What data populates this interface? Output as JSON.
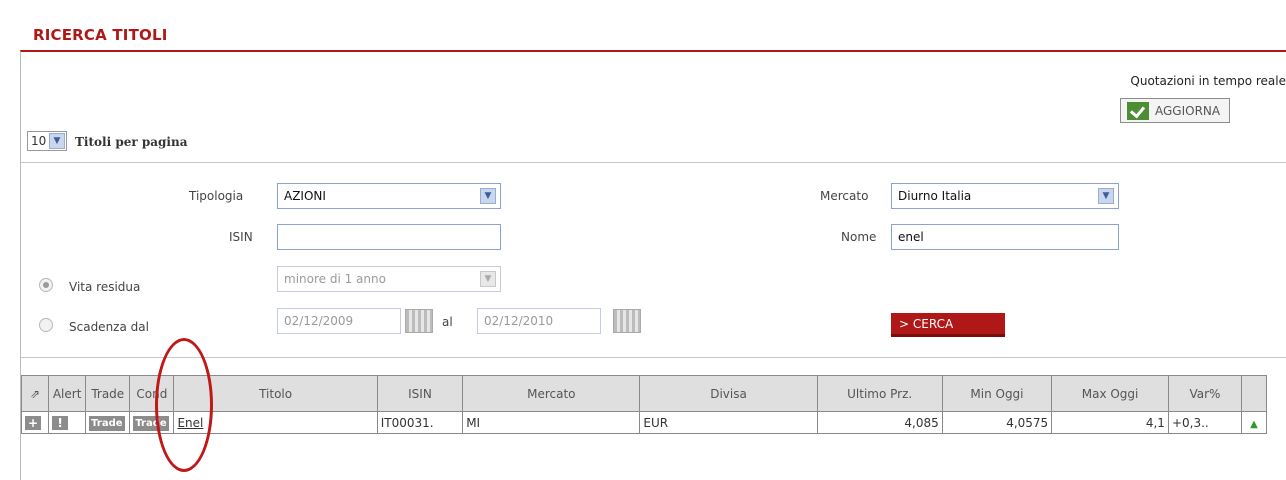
{
  "page": {
    "title": "RICERCA TITOLI",
    "realtime_label": "Quotazioni in tempo reale",
    "refresh_label": "AGGIORNA",
    "per_page_value": "10",
    "per_page_label": "Titoli per pagina"
  },
  "form": {
    "tipologia_label": "Tipologia",
    "tipologia_value": "AZIONI",
    "isin_label": "ISIN",
    "isin_value": "",
    "vita_residua_label": "Vita residua",
    "vita_residua_value": "minore di 1 anno",
    "scadenza_label": "Scadenza dal",
    "scadenza_from": "02/12/2009",
    "al_label": "al",
    "scadenza_to": "02/12/2010",
    "mercato_label": "Mercato",
    "mercato_value": "Diurno Italia",
    "nome_label": "Nome",
    "nome_value": "enel",
    "search_label": "> CERCA"
  },
  "table": {
    "headers": [
      "",
      "Alert",
      "Trade",
      "Cond",
      "Titolo",
      "ISIN",
      "Mercato",
      "Divisa",
      "Ultimo Prz.",
      "Min Oggi",
      "Max Oggi",
      "Var%",
      ""
    ],
    "rows": [
      {
        "add": "+",
        "alert": "!",
        "trade": "Trade",
        "cond": "Trade",
        "titolo": "Enel",
        "isin": "IT00031.",
        "mercato": "MI",
        "divisa": "EUR",
        "ultimo": "4,085",
        "min": "4,0575",
        "max": "4,1",
        "var": "+0,3..",
        "trend": "▲"
      }
    ]
  },
  "colors": {
    "accent": "#b01818",
    "highlight_oval": "#c01818"
  }
}
